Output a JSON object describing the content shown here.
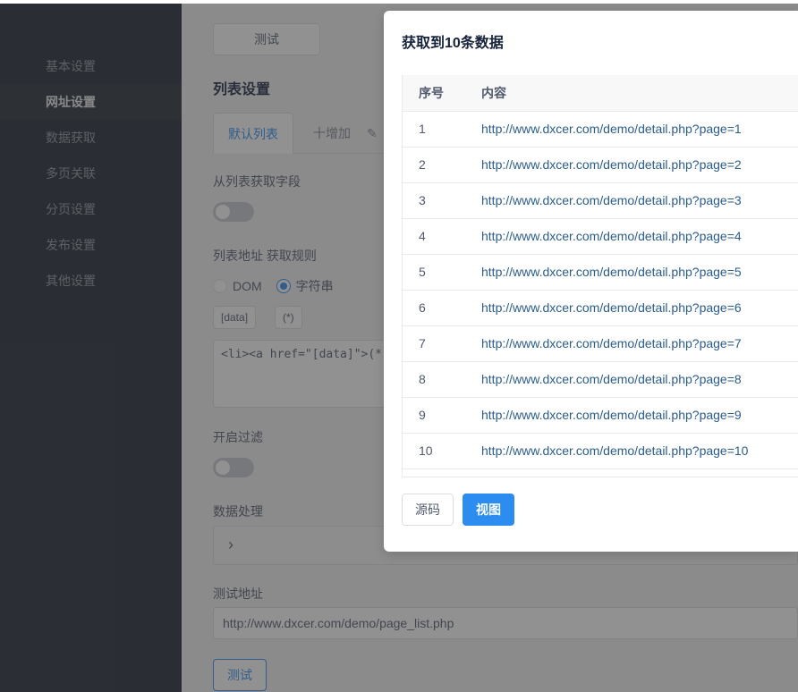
{
  "sidebar": {
    "items": [
      {
        "label": "基本设置"
      },
      {
        "label": "网址设置"
      },
      {
        "label": "数据获取"
      },
      {
        "label": "多页关联"
      },
      {
        "label": "分页设置"
      },
      {
        "label": "发布设置"
      },
      {
        "label": "其他设置"
      }
    ],
    "active_index": 1
  },
  "main": {
    "test_top_label": "测试",
    "section_title": "列表设置",
    "tabs": {
      "default_label": "默认列表",
      "add_label": "十增加",
      "edit_label": "✎"
    },
    "fetch_fields_label": "从列表获取字段",
    "list_rule_label": "列表地址 获取规则",
    "radio_dom": "DOM",
    "radio_string": "字符串",
    "tag_data": "[data]",
    "tag_star": "(*)",
    "rule_value": "<li><a href=\"[data]\">(*)</a",
    "filter_label": "开启过滤",
    "data_process_label": "数据处理",
    "test_url_label": "测试地址",
    "test_url_value": "http://www.dxcer.com/demo/page_list.php",
    "test_bottom_label": "测试"
  },
  "modal": {
    "title": "获取到10条数据",
    "columns": {
      "index": "序号",
      "content": "内容"
    },
    "rows": [
      {
        "index": "1",
        "url": "http://www.dxcer.com/demo/detail.php?page=1"
      },
      {
        "index": "2",
        "url": "http://www.dxcer.com/demo/detail.php?page=2"
      },
      {
        "index": "3",
        "url": "http://www.dxcer.com/demo/detail.php?page=3"
      },
      {
        "index": "4",
        "url": "http://www.dxcer.com/demo/detail.php?page=4"
      },
      {
        "index": "5",
        "url": "http://www.dxcer.com/demo/detail.php?page=5"
      },
      {
        "index": "6",
        "url": "http://www.dxcer.com/demo/detail.php?page=6"
      },
      {
        "index": "7",
        "url": "http://www.dxcer.com/demo/detail.php?page=7"
      },
      {
        "index": "8",
        "url": "http://www.dxcer.com/demo/detail.php?page=8"
      },
      {
        "index": "9",
        "url": "http://www.dxcer.com/demo/detail.php?page=9"
      },
      {
        "index": "10",
        "url": "http://www.dxcer.com/demo/detail.php?page=10"
      }
    ],
    "source_button": "源码",
    "view_button": "视图"
  },
  "colors": {
    "sidebar_bg": "#1c2330",
    "accent": "#2d8cf0",
    "link": "#2b5d8f"
  }
}
